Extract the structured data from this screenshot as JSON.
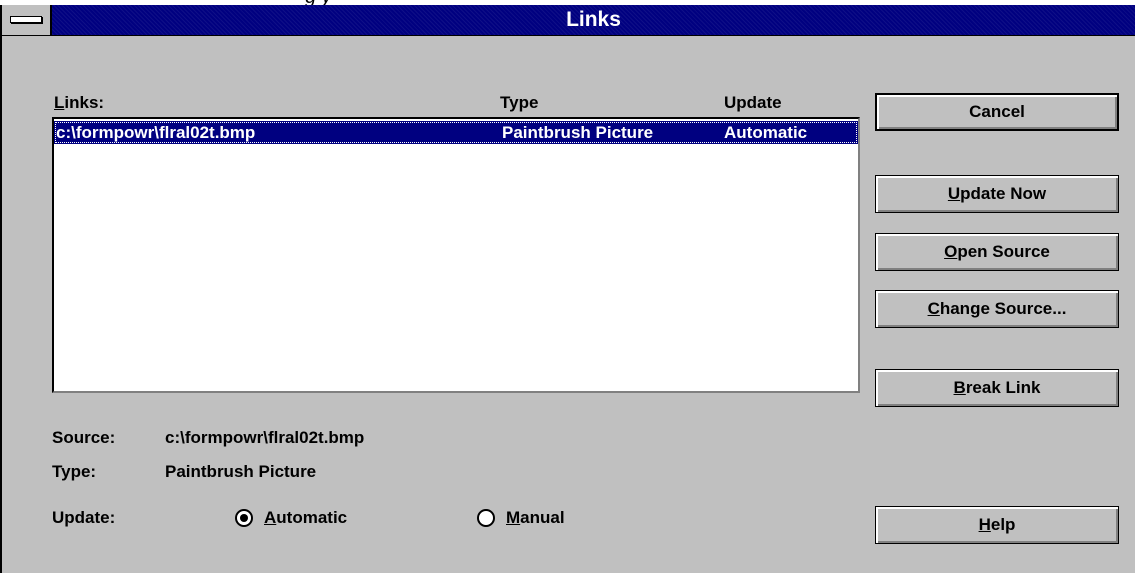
{
  "top_text": "g                          y",
  "window": {
    "title": "Links"
  },
  "list": {
    "label_prefix": "L",
    "label_rest": "inks:",
    "col_type": "Type",
    "col_update": "Update",
    "rows": [
      {
        "name": "c:\\formpowr\\flral02t.bmp",
        "type": "Paintbrush Picture",
        "update": "Automatic"
      }
    ]
  },
  "details": {
    "source_label": "Source:",
    "source_value": "c:\\formpowr\\flral02t.bmp",
    "type_label": "Type:",
    "type_value": "Paintbrush Picture",
    "update_label": "Update:"
  },
  "radios": {
    "automatic": {
      "mnemonic": "A",
      "rest": "utomatic",
      "checked": true
    },
    "manual": {
      "mnemonic": "M",
      "rest": "anual",
      "checked": false
    }
  },
  "buttons": {
    "cancel": {
      "label": "Cancel"
    },
    "update_now": {
      "mnemonic": "U",
      "rest": "pdate Now"
    },
    "open_source": {
      "mnemonic": "O",
      "rest": "pen Source"
    },
    "change_source": {
      "mnemonic": "C",
      "rest": "hange Source..."
    },
    "break_link": {
      "mnemonic": "B",
      "rest": "reak Link"
    },
    "help": {
      "mnemonic": "H",
      "rest": "elp"
    }
  },
  "colors": {
    "titlebar": "#000080",
    "face": "#c0c0c0",
    "selection": "#000080"
  }
}
